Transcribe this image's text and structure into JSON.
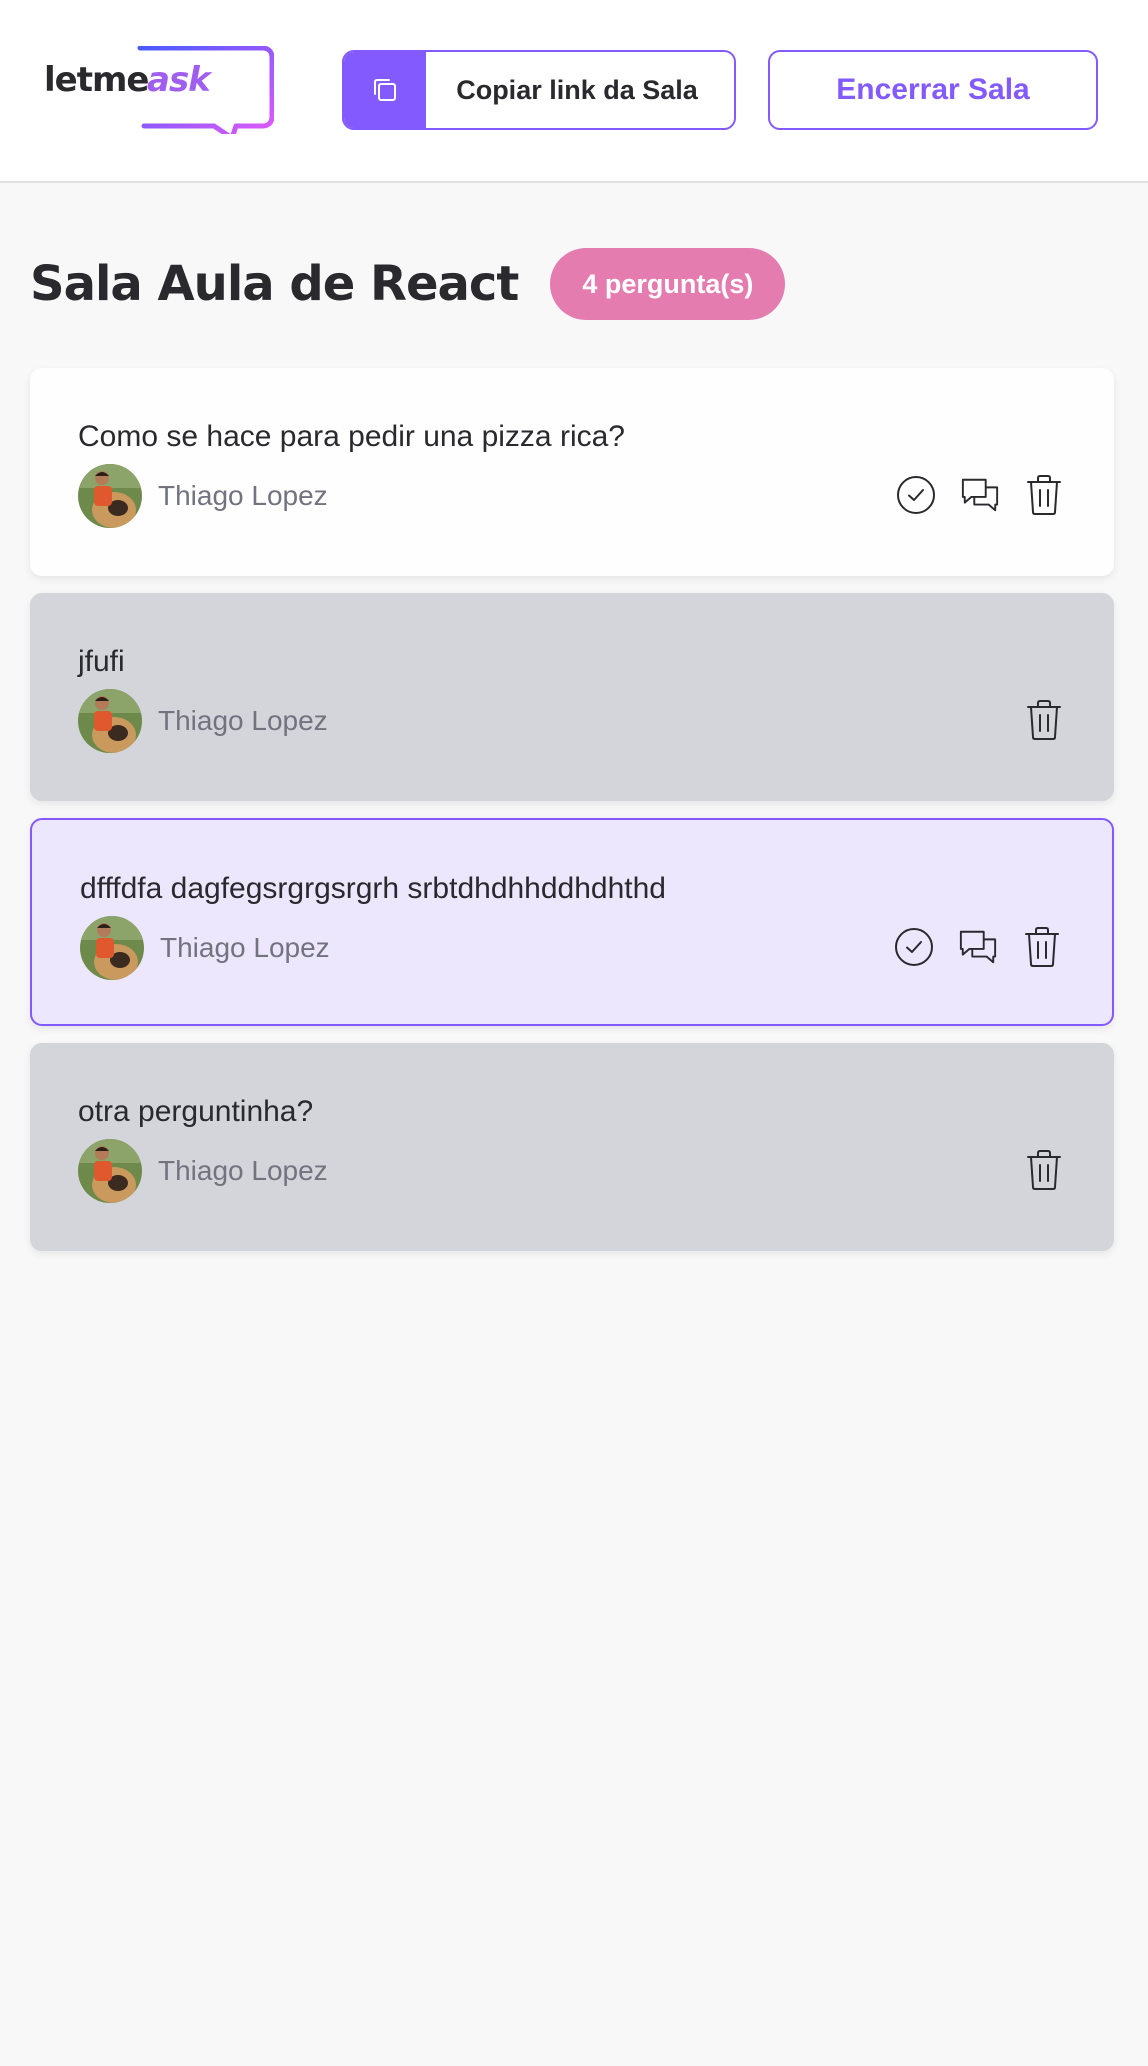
{
  "header": {
    "logo": {
      "letme": "letme",
      "ask": "ask"
    },
    "copy_button_label": "Copiar link da Sala",
    "close_button_label": "Encerrar Sala"
  },
  "room": {
    "title": "Sala Aula de React",
    "badge": "4 pergunta(s)"
  },
  "questions": [
    {
      "content": "Como se hace para pedir una pizza rica?",
      "author": "Thiago Lopez",
      "state": "normal",
      "actions": [
        "check-icon",
        "chat-icon",
        "trash-icon"
      ]
    },
    {
      "content": "jfufi",
      "author": "Thiago Lopez",
      "state": "answered",
      "actions": [
        "trash-icon"
      ]
    },
    {
      "content": "dfffdfa dagfegsrgrgsrgrh srbtdhdhhddhdhthd",
      "author": "Thiago Lopez",
      "state": "highlighted",
      "actions": [
        "check-icon",
        "chat-icon",
        "trash-icon"
      ]
    },
    {
      "content": "otra perguntinha?",
      "author": "Thiago Lopez",
      "state": "answered",
      "actions": [
        "trash-icon"
      ]
    }
  ],
  "colors": {
    "accent": "#835afd",
    "badge": "#e57cb0",
    "answered_bg": "#d3d5da",
    "highlighted_bg": "#ece7fc"
  }
}
